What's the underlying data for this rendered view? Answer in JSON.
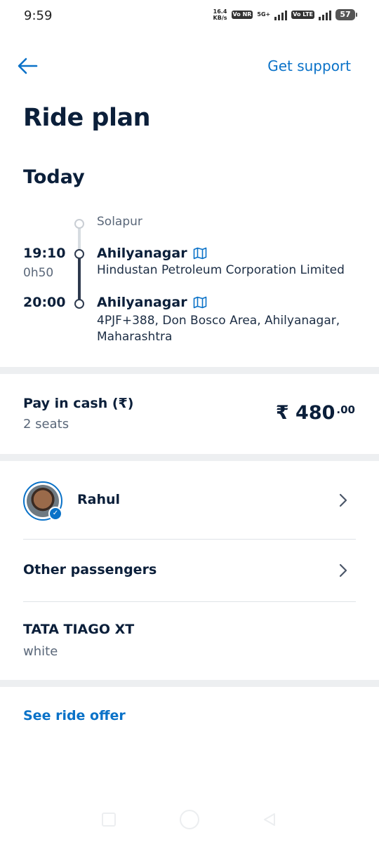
{
  "status_bar": {
    "time": "9:59",
    "net_speed_value": "16.4",
    "net_speed_unit": "KB/s",
    "chip_vonr": "Vo NR",
    "network_5g": "5G+",
    "chip_volte": "Vo LTE",
    "battery": "57"
  },
  "header": {
    "back_icon": "arrow-left-icon",
    "support_label": "Get support",
    "title": "Ride plan"
  },
  "day_label": "Today",
  "itinerary": {
    "origin": "Solapur",
    "pickup": {
      "time": "19:10",
      "duration": "0h50",
      "city": "Ahilyanagar",
      "address": "Hindustan Petroleum Corporation Limited"
    },
    "dropoff": {
      "time": "20:00",
      "city": "Ahilyanagar",
      "address": "4PJF+388, Don Bosco Area, Ahilyanagar, Maharashtra"
    }
  },
  "payment": {
    "label": "Pay in cash (₹)",
    "seats": "2 seats",
    "price_main": "₹ 480",
    "price_decimals": ".00"
  },
  "driver": {
    "name": "Rahul"
  },
  "other_passengers_label": "Other passengers",
  "vehicle": {
    "model": "TATA TIAGO XT",
    "color": "white"
  },
  "see_offer_label": "See ride offer",
  "colors": {
    "accent": "#0a72c8",
    "text_primary": "#0b1f3a",
    "text_secondary": "#5a6779",
    "divider_band": "#edeff1"
  }
}
